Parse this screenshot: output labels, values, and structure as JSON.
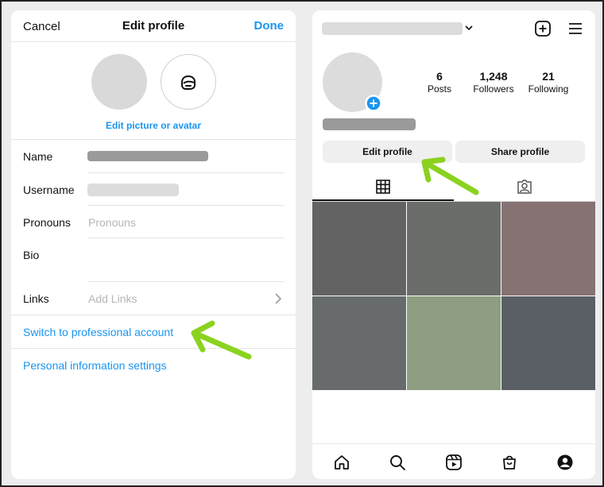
{
  "edit_profile": {
    "cancel_label": "Cancel",
    "title": "Edit profile",
    "done_label": "Done",
    "edit_picture_label": "Edit picture or avatar",
    "fields": {
      "name_label": "Name",
      "username_label": "Username",
      "pronouns_label": "Pronouns",
      "pronouns_placeholder": "Pronouns",
      "bio_label": "Bio",
      "links_label": "Links",
      "links_placeholder": "Add Links"
    },
    "switch_professional_label": "Switch to professional account",
    "personal_info_label": "Personal information settings"
  },
  "profile": {
    "stats": [
      {
        "value": "6",
        "label": "Posts"
      },
      {
        "value": "1,248",
        "label": "Followers"
      },
      {
        "value": "21",
        "label": "Following"
      }
    ],
    "edit_profile_label": "Edit profile",
    "share_profile_label": "Share profile",
    "grid_colors": [
      "#636363",
      "#6a6d69",
      "#867273",
      "#676b6c",
      "#8d9e82",
      "#5a5f66"
    ]
  },
  "colors": {
    "accent_blue": "#1a95f0",
    "annotation_green": "#8bd21f",
    "redacted_gray": "#9a9a9a"
  },
  "icons": {
    "avatar_icon": "avatar-sticker-icon",
    "add_icon": "plus-square-icon",
    "menu_icon": "hamburger-menu-icon",
    "nav": [
      "home-icon",
      "search-icon",
      "reels-icon",
      "shop-icon",
      "profile-icon"
    ]
  }
}
